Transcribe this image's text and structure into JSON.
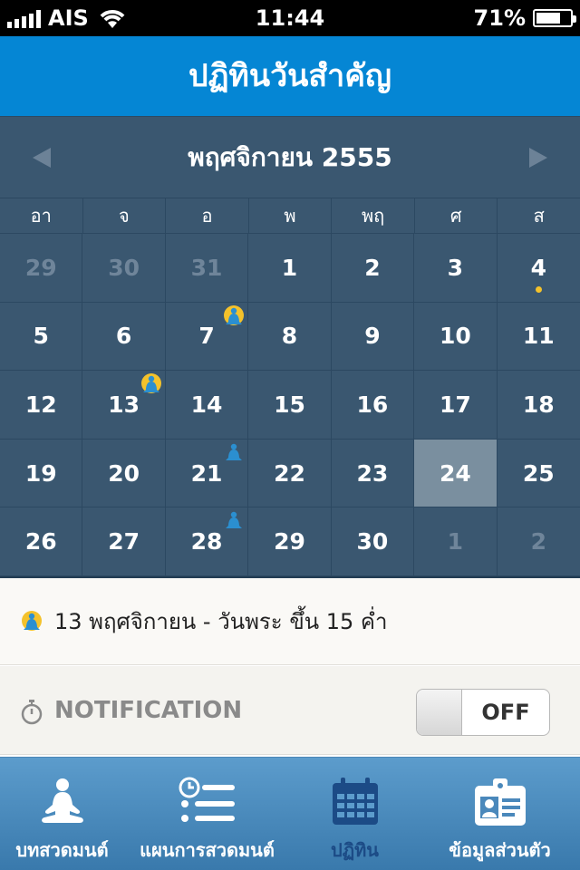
{
  "status_bar": {
    "carrier": "AIS",
    "time": "11:44",
    "battery_percent": "71%",
    "battery_level": 0.71
  },
  "header": {
    "title": "ปฏิทินวันสำคัญ"
  },
  "calendar": {
    "month_label": "พฤศจิกายน 2555",
    "weekdays": [
      "อา",
      "จ",
      "อ",
      "พ",
      "พฤ",
      "ศ",
      "ส"
    ],
    "weeks": [
      [
        {
          "d": "29",
          "muted": true
        },
        {
          "d": "30",
          "muted": true
        },
        {
          "d": "31",
          "muted": true
        },
        {
          "d": "1"
        },
        {
          "d": "2"
        },
        {
          "d": "3"
        },
        {
          "d": "4",
          "dot": true
        }
      ],
      [
        {
          "d": "5"
        },
        {
          "d": "6"
        },
        {
          "d": "7",
          "icon": "monk-halo"
        },
        {
          "d": "8"
        },
        {
          "d": "9"
        },
        {
          "d": "10"
        },
        {
          "d": "11"
        }
      ],
      [
        {
          "d": "12"
        },
        {
          "d": "13",
          "icon": "monk-halo"
        },
        {
          "d": "14"
        },
        {
          "d": "15"
        },
        {
          "d": "16"
        },
        {
          "d": "17"
        },
        {
          "d": "18"
        }
      ],
      [
        {
          "d": "19"
        },
        {
          "d": "20"
        },
        {
          "d": "21",
          "icon": "monk-crescent"
        },
        {
          "d": "22"
        },
        {
          "d": "23"
        },
        {
          "d": "24",
          "selected": true
        },
        {
          "d": "25"
        }
      ],
      [
        {
          "d": "26"
        },
        {
          "d": "27"
        },
        {
          "d": "28",
          "icon": "monk-crescent"
        },
        {
          "d": "29"
        },
        {
          "d": "30"
        },
        {
          "d": "1",
          "muted": true
        },
        {
          "d": "2",
          "muted": true
        }
      ]
    ]
  },
  "event_info": {
    "icon": "monk-halo-icon",
    "text": "13 พฤศจิกายน - วันพระ ขึ้น 15 ค่ำ"
  },
  "notification": {
    "label": "NOTIFICATION",
    "toggle_state": "OFF"
  },
  "tabs": [
    {
      "label": "บทสวดมนต์",
      "icon": "meditation-icon",
      "active": false
    },
    {
      "label": "แผนการสวดมนต์",
      "icon": "schedule-list-icon",
      "active": false
    },
    {
      "label": "ปฏิทิน",
      "icon": "calendar-icon",
      "active": true
    },
    {
      "label": "ข้อมูลส่วนตัว",
      "icon": "id-card-icon",
      "active": false
    }
  ],
  "colors": {
    "header_blue": "#0586d4",
    "calendar_bg": "#3a5770",
    "selected_day": "#7a8f9f",
    "event_yellow": "#f4c22b",
    "tab_active": "#1c4b86"
  }
}
